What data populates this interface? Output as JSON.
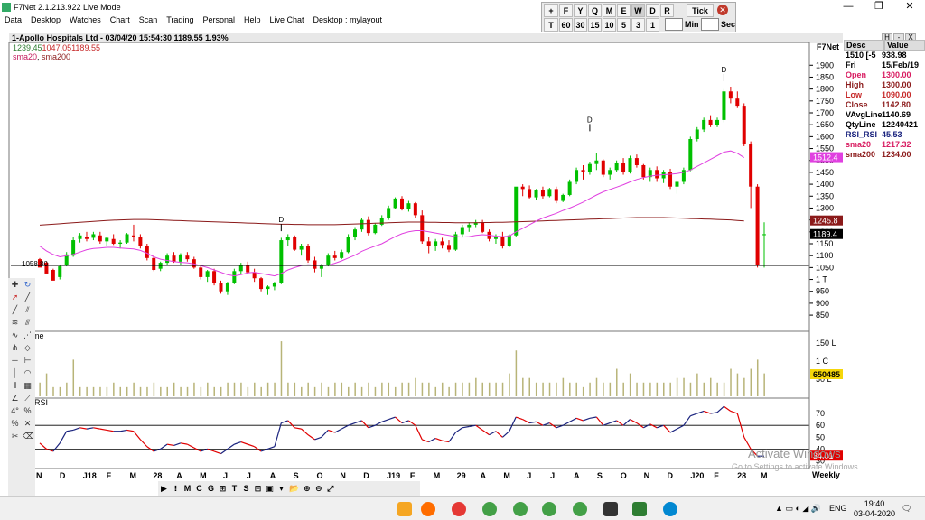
{
  "window": {
    "title": "F7Net 2.1.213.922 Live Mode",
    "controls": [
      "—",
      "❐",
      "✕"
    ]
  },
  "menu": [
    "Data",
    "Desktop",
    "Watches",
    "Chart",
    "Scan",
    "Trading",
    "Personal",
    "Help",
    "Live Chat",
    "Desktop : mylayout"
  ],
  "toolbar": {
    "row1": [
      "+",
      "F",
      "Y",
      "Q",
      "M",
      "E",
      "W",
      "D",
      "R",
      "Tick"
    ],
    "row2": [
      "T",
      "60",
      "30",
      "15",
      "10",
      "5",
      "3",
      "1",
      "",
      "Min",
      "",
      "Sec"
    ]
  },
  "chart_header": {
    "title": "1-Apollo Hospitals Ltd - 03/04/20 15:54:30 1189.55 1.93%",
    "ohl_green": "1239.45",
    "ohl_red": "1047.05",
    "ohl_last": "1189.55",
    "sma20_label": "sma20",
    "sma200_label": "sma200",
    "f7net": "F7Net"
  },
  "side_panel": {
    "tabs": [
      "H",
      "-",
      "X"
    ],
    "headers": [
      "Desc",
      "Value"
    ],
    "rows": [
      {
        "desc": "1510 [-5",
        "value": "938.98",
        "color": "#000000"
      },
      {
        "desc": "Fri",
        "value": "15/Feb/19",
        "color": "#000000"
      },
      {
        "desc": "Open",
        "value": "1300.00",
        "color": "#d81b60"
      },
      {
        "desc": "High",
        "value": "1300.00",
        "color": "#8b1a1a"
      },
      {
        "desc": "Low",
        "value": "1090.00",
        "color": "#c62828"
      },
      {
        "desc": "Close",
        "value": "1142.80",
        "color": "#8b1a1a"
      },
      {
        "desc": "VAvgLine",
        "value": "1140.69",
        "color": "#000000"
      },
      {
        "desc": "QtyLine",
        "value": "12240421",
        "color": "#000000"
      },
      {
        "desc": "RSI_RSI",
        "value": "45.53",
        "color": "#1a237e"
      },
      {
        "desc": "sma20",
        "value": "1217.32",
        "color": "#d81b60"
      },
      {
        "desc": "sma200",
        "value": "1234.00",
        "color": "#8b1a1a"
      }
    ]
  },
  "price_axis": {
    "ticks": [
      "1900",
      "1850",
      "1800",
      "1750",
      "1700",
      "1650",
      "1600",
      "1550",
      "1500",
      "1450",
      "1400",
      "1350",
      "1300",
      "1250",
      "1200",
      "1150",
      "1100",
      "1050",
      "1 T",
      "950",
      "900",
      "850"
    ],
    "marker_sma20": "1512.4",
    "marker_sma200": "1245.8",
    "marker_last": "1189.4",
    "left_marker": "1058.80"
  },
  "volume_axis": {
    "label": "me",
    "ticks": [
      "150 L",
      "1 C",
      "50 L"
    ],
    "marker": "650485"
  },
  "rsi_axis": {
    "label": "RSI",
    "ticks": [
      "70",
      "60",
      "50",
      "40",
      "30"
    ],
    "marker": "34.01"
  },
  "x_axis": [
    "N",
    "D",
    "J18",
    "F",
    "M",
    "28",
    "A",
    "M",
    "J",
    "J",
    "A",
    "S",
    "O",
    "N",
    "D",
    "J19",
    "F",
    "M",
    "29",
    "A",
    "M",
    "J",
    "J",
    "A",
    "S",
    "O",
    "N",
    "D",
    "J20",
    "F",
    "28",
    "M"
  ],
  "weekly_label": "Weekly",
  "watermark": {
    "line1": "Activate Windows",
    "line2": "Go to Settings to activate Windows."
  },
  "markers": [
    "D",
    "D",
    "D"
  ],
  "bottom_toolbar": [
    "▶",
    "⁝",
    "M",
    "C",
    "G",
    "⊞",
    "T",
    "S",
    "⊟",
    "▣",
    "▾"
  ],
  "taskbar": {
    "time": "19:40",
    "date": "03-04-2020",
    "lang": "ENG"
  },
  "colors": {
    "up": "#00c000",
    "down": "#e00000",
    "sma20": "#e040e0",
    "sma200": "#8b1a1a",
    "rsi_up": "#1a237e",
    "rsi_down": "#e00000",
    "volume": "#b8b478"
  },
  "chart_data": {
    "type": "candlestick",
    "title": "1-Apollo Hospitals Ltd",
    "ylim": [
      820,
      1920
    ],
    "candles": [
      [
        1085,
        1090,
        1055,
        1050
      ],
      [
        1070,
        1075,
        1035,
        1025
      ],
      [
        1040,
        1045,
        1005,
        995
      ],
      [
        1010,
        1060,
        1000,
        1055
      ],
      [
        1060,
        1115,
        1055,
        1105
      ],
      [
        1100,
        1180,
        1095,
        1165
      ],
      [
        1170,
        1195,
        1155,
        1185
      ],
      [
        1180,
        1200,
        1160,
        1170
      ],
      [
        1175,
        1200,
        1165,
        1190
      ],
      [
        1185,
        1200,
        1150,
        1160
      ],
      [
        1160,
        1180,
        1140,
        1175
      ],
      [
        1170,
        1190,
        1145,
        1150
      ],
      [
        1150,
        1165,
        1130,
        1155
      ],
      [
        1155,
        1195,
        1150,
        1190
      ],
      [
        1185,
        1230,
        1160,
        1180
      ],
      [
        1180,
        1190,
        1130,
        1140
      ],
      [
        1140,
        1150,
        1080,
        1090
      ],
      [
        1090,
        1100,
        1035,
        1040
      ],
      [
        1045,
        1075,
        1035,
        1070
      ],
      [
        1070,
        1110,
        1060,
        1100
      ],
      [
        1100,
        1115,
        1070,
        1075
      ],
      [
        1075,
        1110,
        1060,
        1105
      ],
      [
        1100,
        1115,
        1075,
        1085
      ],
      [
        1085,
        1095,
        1045,
        1050
      ],
      [
        1050,
        1060,
        1000,
        1010
      ],
      [
        1010,
        1040,
        990,
        1035
      ],
      [
        1035,
        1045,
        975,
        985
      ],
      [
        985,
        995,
        940,
        950
      ],
      [
        950,
        990,
        935,
        985
      ],
      [
        985,
        1045,
        980,
        1035
      ],
      [
        1035,
        1070,
        1020,
        1060
      ],
      [
        1060,
        1075,
        1025,
        1030
      ],
      [
        1030,
        1045,
        990,
        1005
      ],
      [
        1005,
        1010,
        950,
        960
      ],
      [
        960,
        975,
        935,
        970
      ],
      [
        970,
        990,
        955,
        985
      ],
      [
        985,
        1175,
        980,
        1165
      ],
      [
        1165,
        1190,
        1140,
        1180
      ],
      [
        1180,
        1185,
        1120,
        1125
      ],
      [
        1125,
        1150,
        1100,
        1140
      ],
      [
        1140,
        1150,
        1070,
        1080
      ],
      [
        1080,
        1095,
        1030,
        1045
      ],
      [
        1045,
        1065,
        1010,
        1060
      ],
      [
        1060,
        1110,
        1055,
        1100
      ],
      [
        1100,
        1120,
        1080,
        1090
      ],
      [
        1090,
        1125,
        1085,
        1115
      ],
      [
        1115,
        1190,
        1110,
        1180
      ],
      [
        1180,
        1220,
        1165,
        1210
      ],
      [
        1210,
        1260,
        1200,
        1250
      ],
      [
        1250,
        1265,
        1185,
        1195
      ],
      [
        1195,
        1235,
        1190,
        1230
      ],
      [
        1230,
        1270,
        1225,
        1260
      ],
      [
        1260,
        1310,
        1250,
        1300
      ],
      [
        1300,
        1345,
        1295,
        1340
      ],
      [
        1340,
        1350,
        1290,
        1295
      ],
      [
        1295,
        1330,
        1285,
        1320
      ],
      [
        1320,
        1325,
        1260,
        1270
      ],
      [
        1270,
        1290,
        1150,
        1160
      ],
      [
        1160,
        1180,
        1110,
        1140
      ],
      [
        1140,
        1170,
        1120,
        1160
      ],
      [
        1160,
        1175,
        1130,
        1145
      ],
      [
        1145,
        1165,
        1115,
        1125
      ],
      [
        1125,
        1200,
        1120,
        1190
      ],
      [
        1190,
        1230,
        1180,
        1220
      ],
      [
        1220,
        1240,
        1200,
        1230
      ],
      [
        1230,
        1250,
        1220,
        1240
      ],
      [
        1240,
        1250,
        1195,
        1200
      ],
      [
        1200,
        1210,
        1160,
        1170
      ],
      [
        1170,
        1190,
        1150,
        1180
      ],
      [
        1180,
        1200,
        1130,
        1140
      ],
      [
        1140,
        1190,
        1135,
        1185
      ],
      [
        1185,
        1300,
        1180,
        1390
      ],
      [
        1390,
        1400,
        1350,
        1380
      ],
      [
        1380,
        1395,
        1340,
        1345
      ],
      [
        1345,
        1380,
        1335,
        1375
      ],
      [
        1375,
        1390,
        1340,
        1350
      ],
      [
        1350,
        1385,
        1345,
        1380
      ],
      [
        1380,
        1390,
        1320,
        1330
      ],
      [
        1330,
        1360,
        1325,
        1355
      ],
      [
        1355,
        1420,
        1350,
        1410
      ],
      [
        1410,
        1470,
        1400,
        1460
      ],
      [
        1460,
        1480,
        1420,
        1450
      ],
      [
        1450,
        1495,
        1440,
        1485
      ],
      [
        1485,
        1530,
        1460,
        1500
      ],
      [
        1500,
        1505,
        1430,
        1440
      ],
      [
        1440,
        1470,
        1420,
        1460
      ],
      [
        1460,
        1500,
        1450,
        1490
      ],
      [
        1490,
        1510,
        1440,
        1450
      ],
      [
        1450,
        1520,
        1445,
        1510
      ],
      [
        1510,
        1525,
        1470,
        1480
      ],
      [
        1480,
        1485,
        1420,
        1430
      ],
      [
        1430,
        1470,
        1410,
        1460
      ],
      [
        1460,
        1475,
        1410,
        1425
      ],
      [
        1425,
        1460,
        1405,
        1450
      ],
      [
        1450,
        1465,
        1380,
        1390
      ],
      [
        1390,
        1420,
        1360,
        1410
      ],
      [
        1410,
        1470,
        1400,
        1460
      ],
      [
        1460,
        1600,
        1455,
        1590
      ],
      [
        1590,
        1640,
        1580,
        1630
      ],
      [
        1630,
        1680,
        1620,
        1670
      ],
      [
        1670,
        1690,
        1640,
        1650
      ],
      [
        1650,
        1680,
        1640,
        1670
      ],
      [
        1670,
        1800,
        1660,
        1790
      ],
      [
        1790,
        1810,
        1740,
        1760
      ],
      [
        1760,
        1790,
        1720,
        1730
      ],
      [
        1730,
        1740,
        1560,
        1570
      ],
      [
        1570,
        1580,
        1300,
        1390
      ],
      [
        1390,
        1400,
        1050,
        1060
      ],
      [
        1190,
        1240,
        1050,
        1190
      ]
    ],
    "sma20": [
      1140,
      1120,
      1105,
      1095,
      1100,
      1105,
      1115,
      1125,
      1130,
      1132,
      1135,
      1135,
      1132,
      1130,
      1128,
      1122,
      1110,
      1095,
      1085,
      1080,
      1075,
      1072,
      1070,
      1065,
      1058,
      1050,
      1040,
      1030,
      1020,
      1015,
      1020,
      1028,
      1030,
      1025,
      1020,
      1015,
      1025,
      1040,
      1050,
      1058,
      1062,
      1060,
      1058,
      1060,
      1068,
      1078,
      1090,
      1102,
      1118,
      1130,
      1140,
      1150,
      1165,
      1180,
      1192,
      1200,
      1205,
      1205,
      1200,
      1195,
      1190,
      1185,
      1180,
      1178,
      1180,
      1185,
      1188,
      1186,
      1182,
      1180,
      1182,
      1200,
      1215,
      1230,
      1245,
      1258,
      1268,
      1278,
      1290,
      1300,
      1312,
      1325,
      1340,
      1355,
      1368,
      1378,
      1388,
      1398,
      1410,
      1420,
      1428,
      1434,
      1438,
      1440,
      1442,
      1445,
      1450,
      1460,
      1475,
      1490,
      1505,
      1520,
      1535,
      1540,
      1530,
      1512
    ],
    "sma200": [
      1228,
      1230,
      1232,
      1234,
      1236,
      1238,
      1240,
      1242,
      1244,
      1246,
      1248,
      1249,
      1250,
      1251,
      1252,
      1252,
      1252,
      1251,
      1250,
      1249,
      1248,
      1247,
      1246,
      1245,
      1244,
      1243,
      1242,
      1241,
      1240,
      1239,
      1238,
      1237,
      1236,
      1235,
      1234,
      1233,
      1232,
      1232,
      1231,
      1231,
      1230,
      1230,
      1230,
      1230,
      1230,
      1231,
      1232,
      1233,
      1234,
      1235,
      1236,
      1237,
      1238,
      1239,
      1240,
      1241,
      1241,
      1241,
      1240,
      1240,
      1239,
      1239,
      1238,
      1238,
      1238,
      1238,
      1239,
      1239,
      1240,
      1240,
      1241,
      1242,
      1243,
      1244,
      1245,
      1246,
      1247,
      1248,
      1249,
      1250,
      1251,
      1252,
      1253,
      1254,
      1255,
      1256,
      1257,
      1258,
      1259,
      1260,
      1260,
      1260,
      1260,
      1260,
      1259,
      1258,
      1257,
      1256,
      1255,
      1254,
      1253,
      1252,
      1251,
      1250,
      1248,
      1246
    ],
    "volume": [
      3,
      5,
      2,
      2,
      3,
      8,
      2,
      2,
      2,
      2,
      2,
      3,
      2,
      2,
      3,
      2,
      2,
      3,
      2,
      2,
      3,
      2,
      2,
      3,
      2,
      3,
      2,
      2,
      3,
      3,
      3,
      2,
      3,
      2,
      3,
      3,
      12,
      3,
      3,
      2,
      3,
      2,
      3,
      2,
      3,
      3,
      2,
      3,
      2,
      3,
      2,
      3,
      3,
      2,
      3,
      3,
      4,
      3,
      3,
      2,
      3,
      2,
      3,
      3,
      3,
      4,
      3,
      3,
      3,
      3,
      5,
      10,
      4,
      4,
      3,
      3,
      3,
      3,
      4,
      3,
      3,
      2,
      3,
      4,
      3,
      3,
      6,
      3,
      5,
      3,
      3,
      3,
      3,
      3,
      3,
      4,
      4,
      3,
      5,
      3,
      4,
      3,
      3,
      6,
      5,
      4,
      6,
      8,
      5
    ],
    "rsi": [
      45,
      40,
      38,
      45,
      55,
      56,
      58,
      57,
      58,
      57,
      56,
      55,
      55,
      56,
      55,
      48,
      42,
      38,
      40,
      44,
      43,
      45,
      44,
      41,
      38,
      40,
      38,
      36,
      40,
      44,
      46,
      44,
      42,
      38,
      40,
      42,
      62,
      64,
      58,
      57,
      52,
      48,
      50,
      56,
      54,
      57,
      60,
      62,
      64,
      58,
      60,
      63,
      65,
      67,
      62,
      64,
      60,
      48,
      46,
      49,
      47,
      46,
      54,
      58,
      59,
      60,
      56,
      52,
      55,
      50,
      55,
      67,
      65,
      62,
      63,
      60,
      62,
      58,
      60,
      63,
      66,
      64,
      66,
      67,
      60,
      62,
      64,
      60,
      65,
      62,
      58,
      61,
      58,
      60,
      54,
      57,
      60,
      68,
      70,
      72,
      70,
      71,
      76,
      72,
      70,
      50,
      40,
      34,
      34
    ],
    "rsi_ylim": [
      25,
      80
    ],
    "rsi_levels": [
      60,
      40
    ],
    "support_line": 1058.8
  }
}
